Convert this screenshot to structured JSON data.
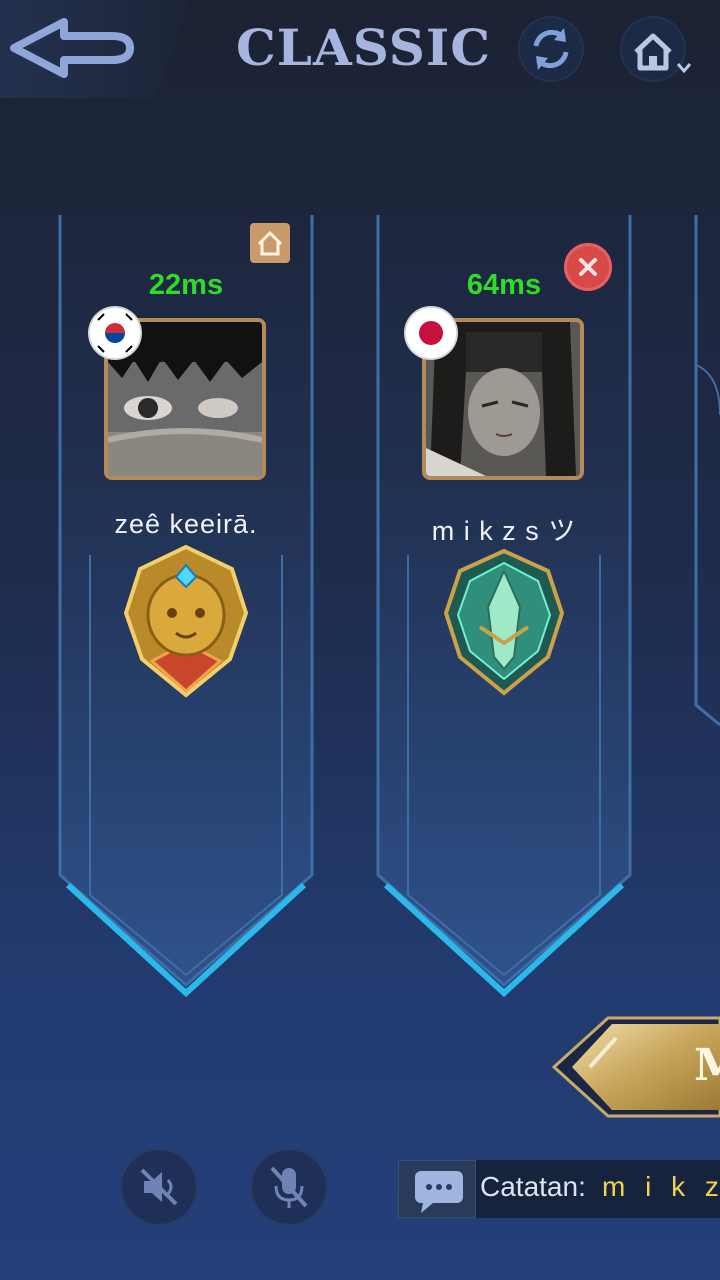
{
  "header": {
    "title": "CLASSIC",
    "back_icon": "back-arrow-icon",
    "refresh_icon": "refresh-icon",
    "home_icon": "home-dropdown-icon"
  },
  "players": [
    {
      "ping": "22ms",
      "name": "zeê keeirā.",
      "flag": "south-korea",
      "rank_icon": "gold-lion-rank-emblem",
      "is_host": true
    },
    {
      "ping": "64ms",
      "name": "m i k z s ツ",
      "flag": "japan",
      "rank_icon": "jade-rank-emblem",
      "is_host": false
    }
  ],
  "bottom": {
    "speaker_icon": "speaker-muted-icon",
    "mic_icon": "mic-muted-icon",
    "chat_icon": "chat-bubble-icon",
    "chat_prefix": "Catatan:",
    "chat_name": "m i k z",
    "play_label": "M"
  },
  "colors": {
    "ping": "#2fdc2a",
    "chat_name": "#f2d24b",
    "title": "#a6b4de",
    "avatar_border": "#b48a56"
  }
}
